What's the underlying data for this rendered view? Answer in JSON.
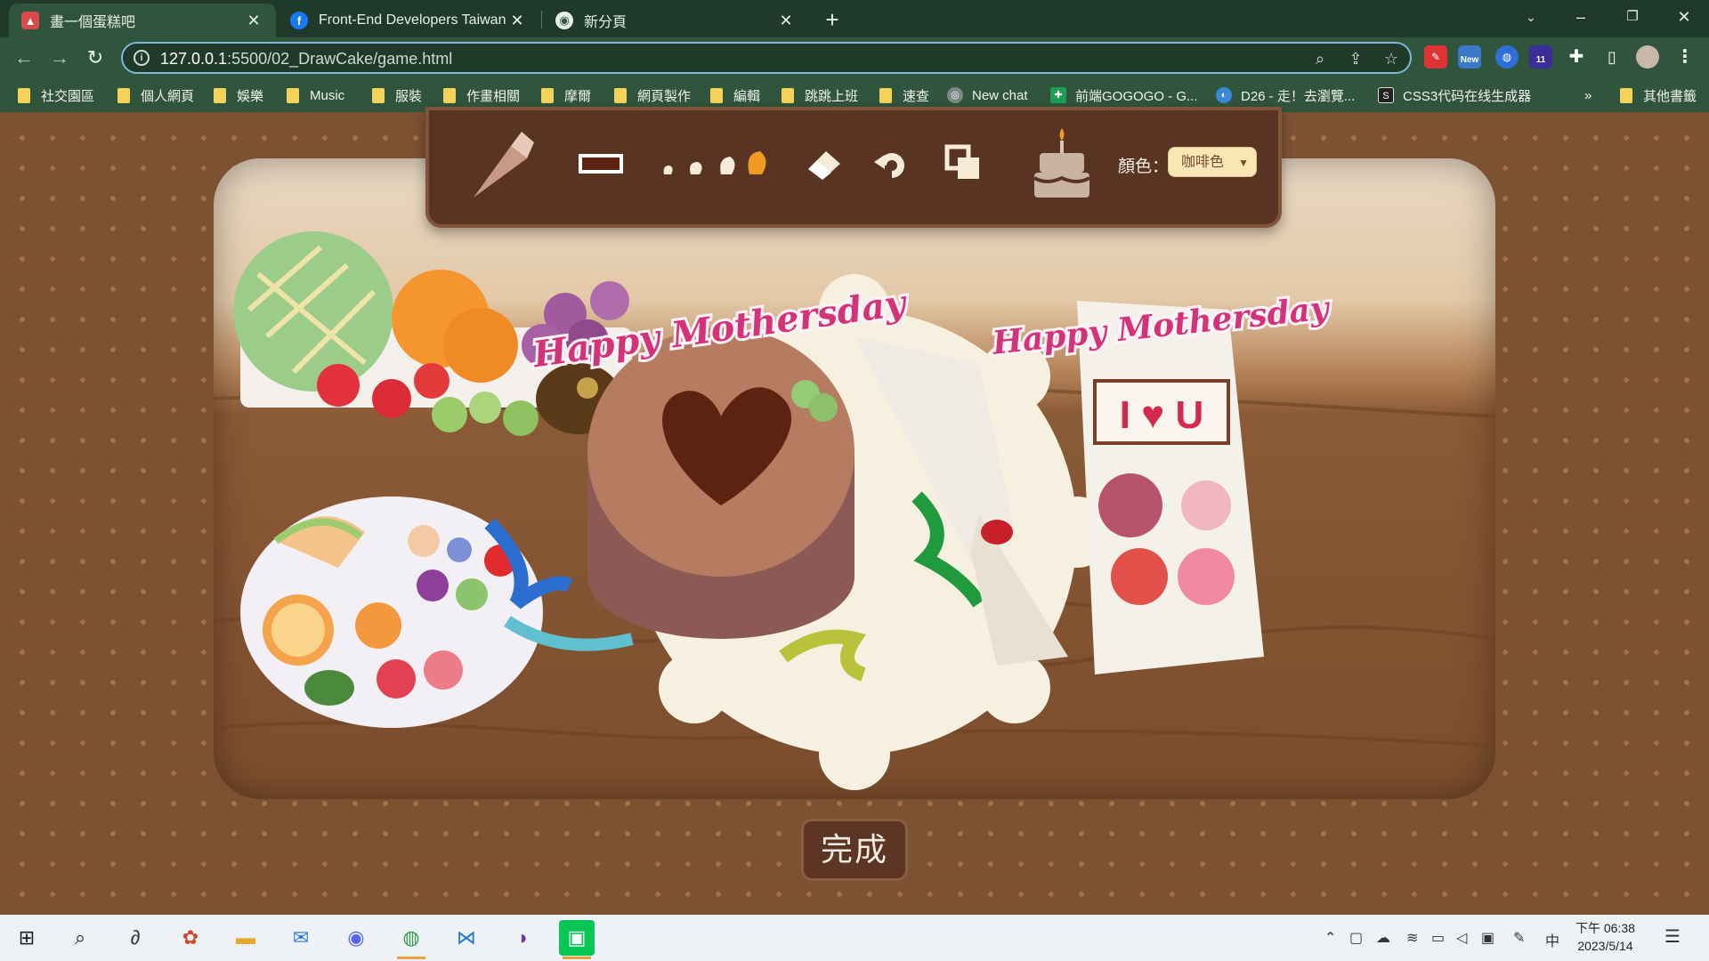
{
  "browser": {
    "tabs": [
      {
        "title": "畫一個蛋糕吧",
        "icon": "cake-icon",
        "active": true
      },
      {
        "title": "Front-End Developers Taiwan |",
        "icon": "facebook-icon",
        "active": false
      },
      {
        "title": "新分頁",
        "icon": "chrome-icon",
        "active": false
      }
    ],
    "url_host": "127.0.0.1",
    "url_path": ":5500/02_DrawCake/game.html",
    "bookmarks": [
      {
        "label": "社交園區",
        "type": "folder"
      },
      {
        "label": "個人網頁",
        "type": "folder"
      },
      {
        "label": "娛樂",
        "type": "folder"
      },
      {
        "label": "Music",
        "type": "folder"
      },
      {
        "label": "服裝",
        "type": "folder"
      },
      {
        "label": "作畫相關",
        "type": "folder"
      },
      {
        "label": "摩爾",
        "type": "folder"
      },
      {
        "label": "網頁製作",
        "type": "folder"
      },
      {
        "label": "編輯",
        "type": "folder"
      },
      {
        "label": "跳跳上班",
        "type": "folder"
      },
      {
        "label": "速查",
        "type": "folder"
      },
      {
        "label": "New chat",
        "type": "link"
      },
      {
        "label": "前端GOGOGO - G...",
        "type": "link"
      },
      {
        "label": "D26 - 走！去瀏覽...",
        "type": "link"
      },
      {
        "label": "CSS3代码在线生成器",
        "type": "link"
      },
      {
        "label": "其他書籤",
        "type": "folder"
      }
    ],
    "more_bookmarks": "»",
    "ext_new_badge": "New",
    "ext_count_badge": "11"
  },
  "game": {
    "toolbar": {
      "color_label": "顏色：",
      "color_value": "咖啡色",
      "selected_color": "#5c2a10"
    },
    "decorations": {
      "topper_text": "Happy Mothersday",
      "sign_text": "I ♥ U"
    },
    "done_label": "完成"
  },
  "taskbar": {
    "clock_period_time": "下午 06:38",
    "clock_date": "2023/5/14",
    "ime": "中"
  },
  "colors": {
    "chrome_dark": "#1f3a2a",
    "chrome_mid": "#31543c",
    "page_bg": "#7d5233",
    "panel": "#5a3422",
    "select_bg": "#fbe6b6"
  }
}
